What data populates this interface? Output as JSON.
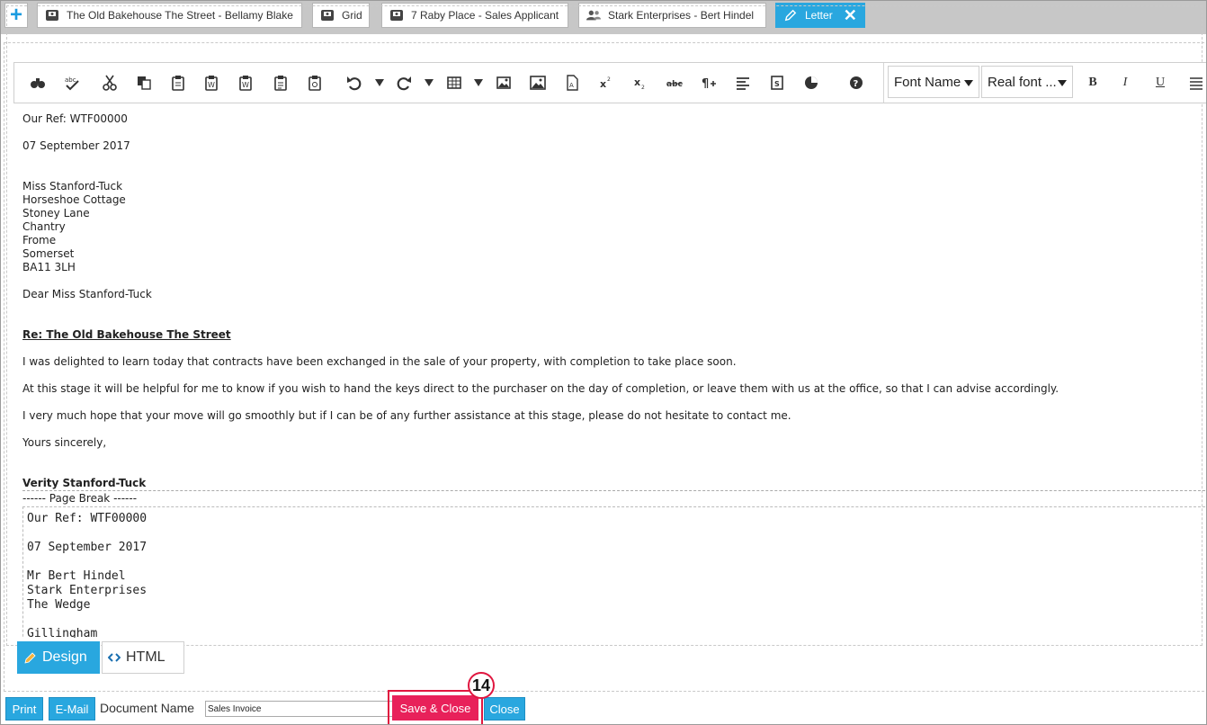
{
  "tabs": {
    "new_symbol": "+",
    "items": [
      {
        "label": "The Old Bakehouse The Street - Bellamy Blake",
        "icon": "property-icon"
      },
      {
        "label": "Grid",
        "icon": "property-icon"
      },
      {
        "label": "7 Raby Place - Sales Applicant",
        "icon": "property-icon"
      },
      {
        "label": "Stark Enterprises - Bert Hindel",
        "icon": "contacts-icon"
      },
      {
        "label": "Letter",
        "icon": "pencil-icon",
        "active": true,
        "close_symbol": "✕"
      }
    ]
  },
  "toolbar": {
    "font_name": "Font Name",
    "font_size": "Real font ...",
    "bold": "B",
    "italic": "I",
    "underline": "U"
  },
  "document": {
    "page1": {
      "ref": "Our Ref: WTF00000",
      "date": "07 September 2017",
      "address": [
        "Miss Stanford-Tuck",
        "Horseshoe Cottage",
        "Stoney Lane",
        "Chantry",
        "Frome",
        "Somerset",
        "BA11 3LH"
      ],
      "salutation": "Dear Miss Stanford-Tuck",
      "subject": "Re: The Old Bakehouse The Street",
      "paragraphs": [
        "I was delighted to learn today that contracts have been exchanged in the sale of your property, with completion to take place soon.",
        "At this stage it will be helpful for me to know if you wish to hand the keys direct to the purchaser on the day of completion, or leave them with us at the office, so that I can advise accordingly.",
        "I very much hope that your move will go smoothly but if I can be of any further assistance at this stage, please do not hesitate to contact me."
      ],
      "closing": "Yours sincerely,",
      "signature": "Verity Stanford-Tuck"
    },
    "page_break": "------ Page Break ------",
    "page2": {
      "ref": "Our Ref: WTF00000",
      "date": "07 September 2017",
      "address": [
        "Mr Bert Hindel",
        "Stark Enterprises",
        "The Wedge",
        "",
        "Gillingham"
      ]
    }
  },
  "modes": {
    "design": "Design",
    "html": "HTML"
  },
  "footer": {
    "print": "Print",
    "email": "E-Mail",
    "document_name_label": "Document Name",
    "document_name_value": "Sales Invoice",
    "save_close": "Save & Close",
    "close": "Close",
    "step_badge": "14"
  },
  "colors": {
    "accent": "#29a7df",
    "save": "#e8215a",
    "highlight": "#e0163f"
  }
}
